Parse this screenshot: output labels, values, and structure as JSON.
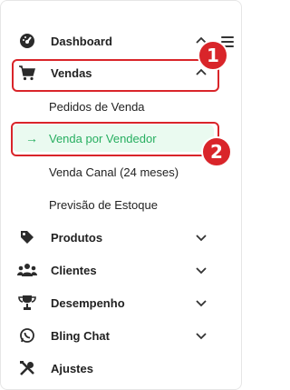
{
  "nav": {
    "dashboard": {
      "label": "Dashboard",
      "icon": "dashboard-icon"
    },
    "vendas": {
      "label": "Vendas",
      "icon": "cart-icon"
    },
    "vendas_sub": {
      "pedidos": "Pedidos de Venda",
      "vendedor": "Venda por Vendedor",
      "canal": "Venda Canal (24 meses)",
      "previsao": "Previsão de Estoque"
    },
    "produtos": {
      "label": "Produtos",
      "icon": "tag-icon"
    },
    "clientes": {
      "label": "Clientes",
      "icon": "users-icon"
    },
    "desempenho": {
      "label": "Desempenho",
      "icon": "trophy-icon"
    },
    "bling_chat": {
      "label": "Bling Chat",
      "icon": "whatsapp-icon"
    },
    "ajustes": {
      "label": "Ajustes",
      "icon": "tools-icon"
    }
  },
  "annotations": {
    "step1": "1",
    "step2": "2"
  },
  "colors": {
    "accent_green": "#27ae60",
    "highlight_red": "#d9252a",
    "active_bg": "#eafaf0"
  }
}
